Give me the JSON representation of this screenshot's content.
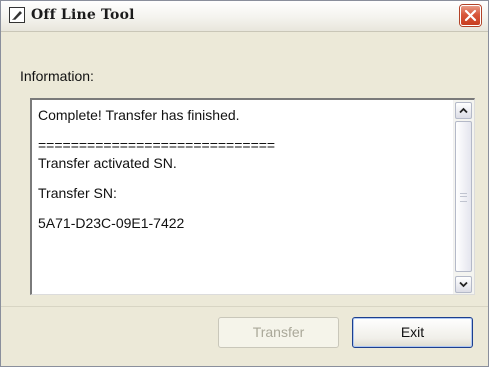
{
  "window": {
    "title": "Off Line Tool"
  },
  "info": {
    "label": "Information:",
    "lines": [
      "Complete! Transfer has finished.",
      "",
      "=============================",
      "Transfer activated SN.",
      "",
      "Transfer SN:",
      "",
      "5A71-D23C-09E1-7422"
    ]
  },
  "buttons": {
    "transfer_label": "Transfer",
    "transfer_disabled": true,
    "exit_label": "Exit"
  },
  "colors": {
    "dialog_bg": "#ece9d8",
    "close_button": "#d8573b",
    "default_button_border": "#1d3f8e"
  }
}
